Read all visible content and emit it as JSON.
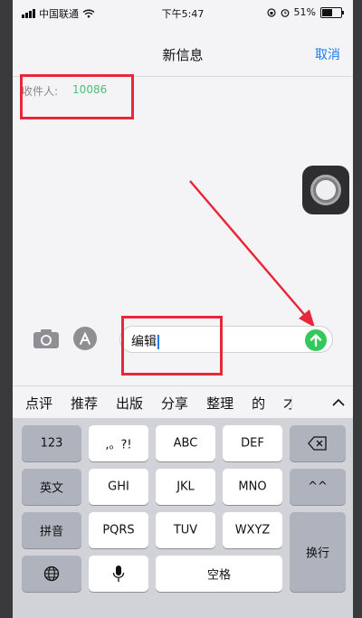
{
  "status": {
    "carrier": "中国联通",
    "time": "下午5:47",
    "battery": "51%"
  },
  "nav": {
    "title": "新信息",
    "cancel": "取消"
  },
  "recipient": {
    "label": "收件人:",
    "value": "10086"
  },
  "message": {
    "text": "编辑"
  },
  "suggestions": [
    "点评",
    "推荐",
    "出版",
    "分享",
    "整理",
    "的",
    "才"
  ],
  "keyboard": {
    "row1": [
      "123",
      ",。?!",
      "ABC",
      "DEF"
    ],
    "row2": [
      "英文",
      "GHI",
      "JKL",
      "MNO",
      "^^"
    ],
    "row3": [
      "拼音",
      "PQRS",
      "TUV",
      "WXYZ"
    ],
    "space": "空格",
    "return": "换行"
  },
  "colors": {
    "highlight": "#e8273b",
    "send": "#34c759",
    "link": "#1a7cf0"
  }
}
